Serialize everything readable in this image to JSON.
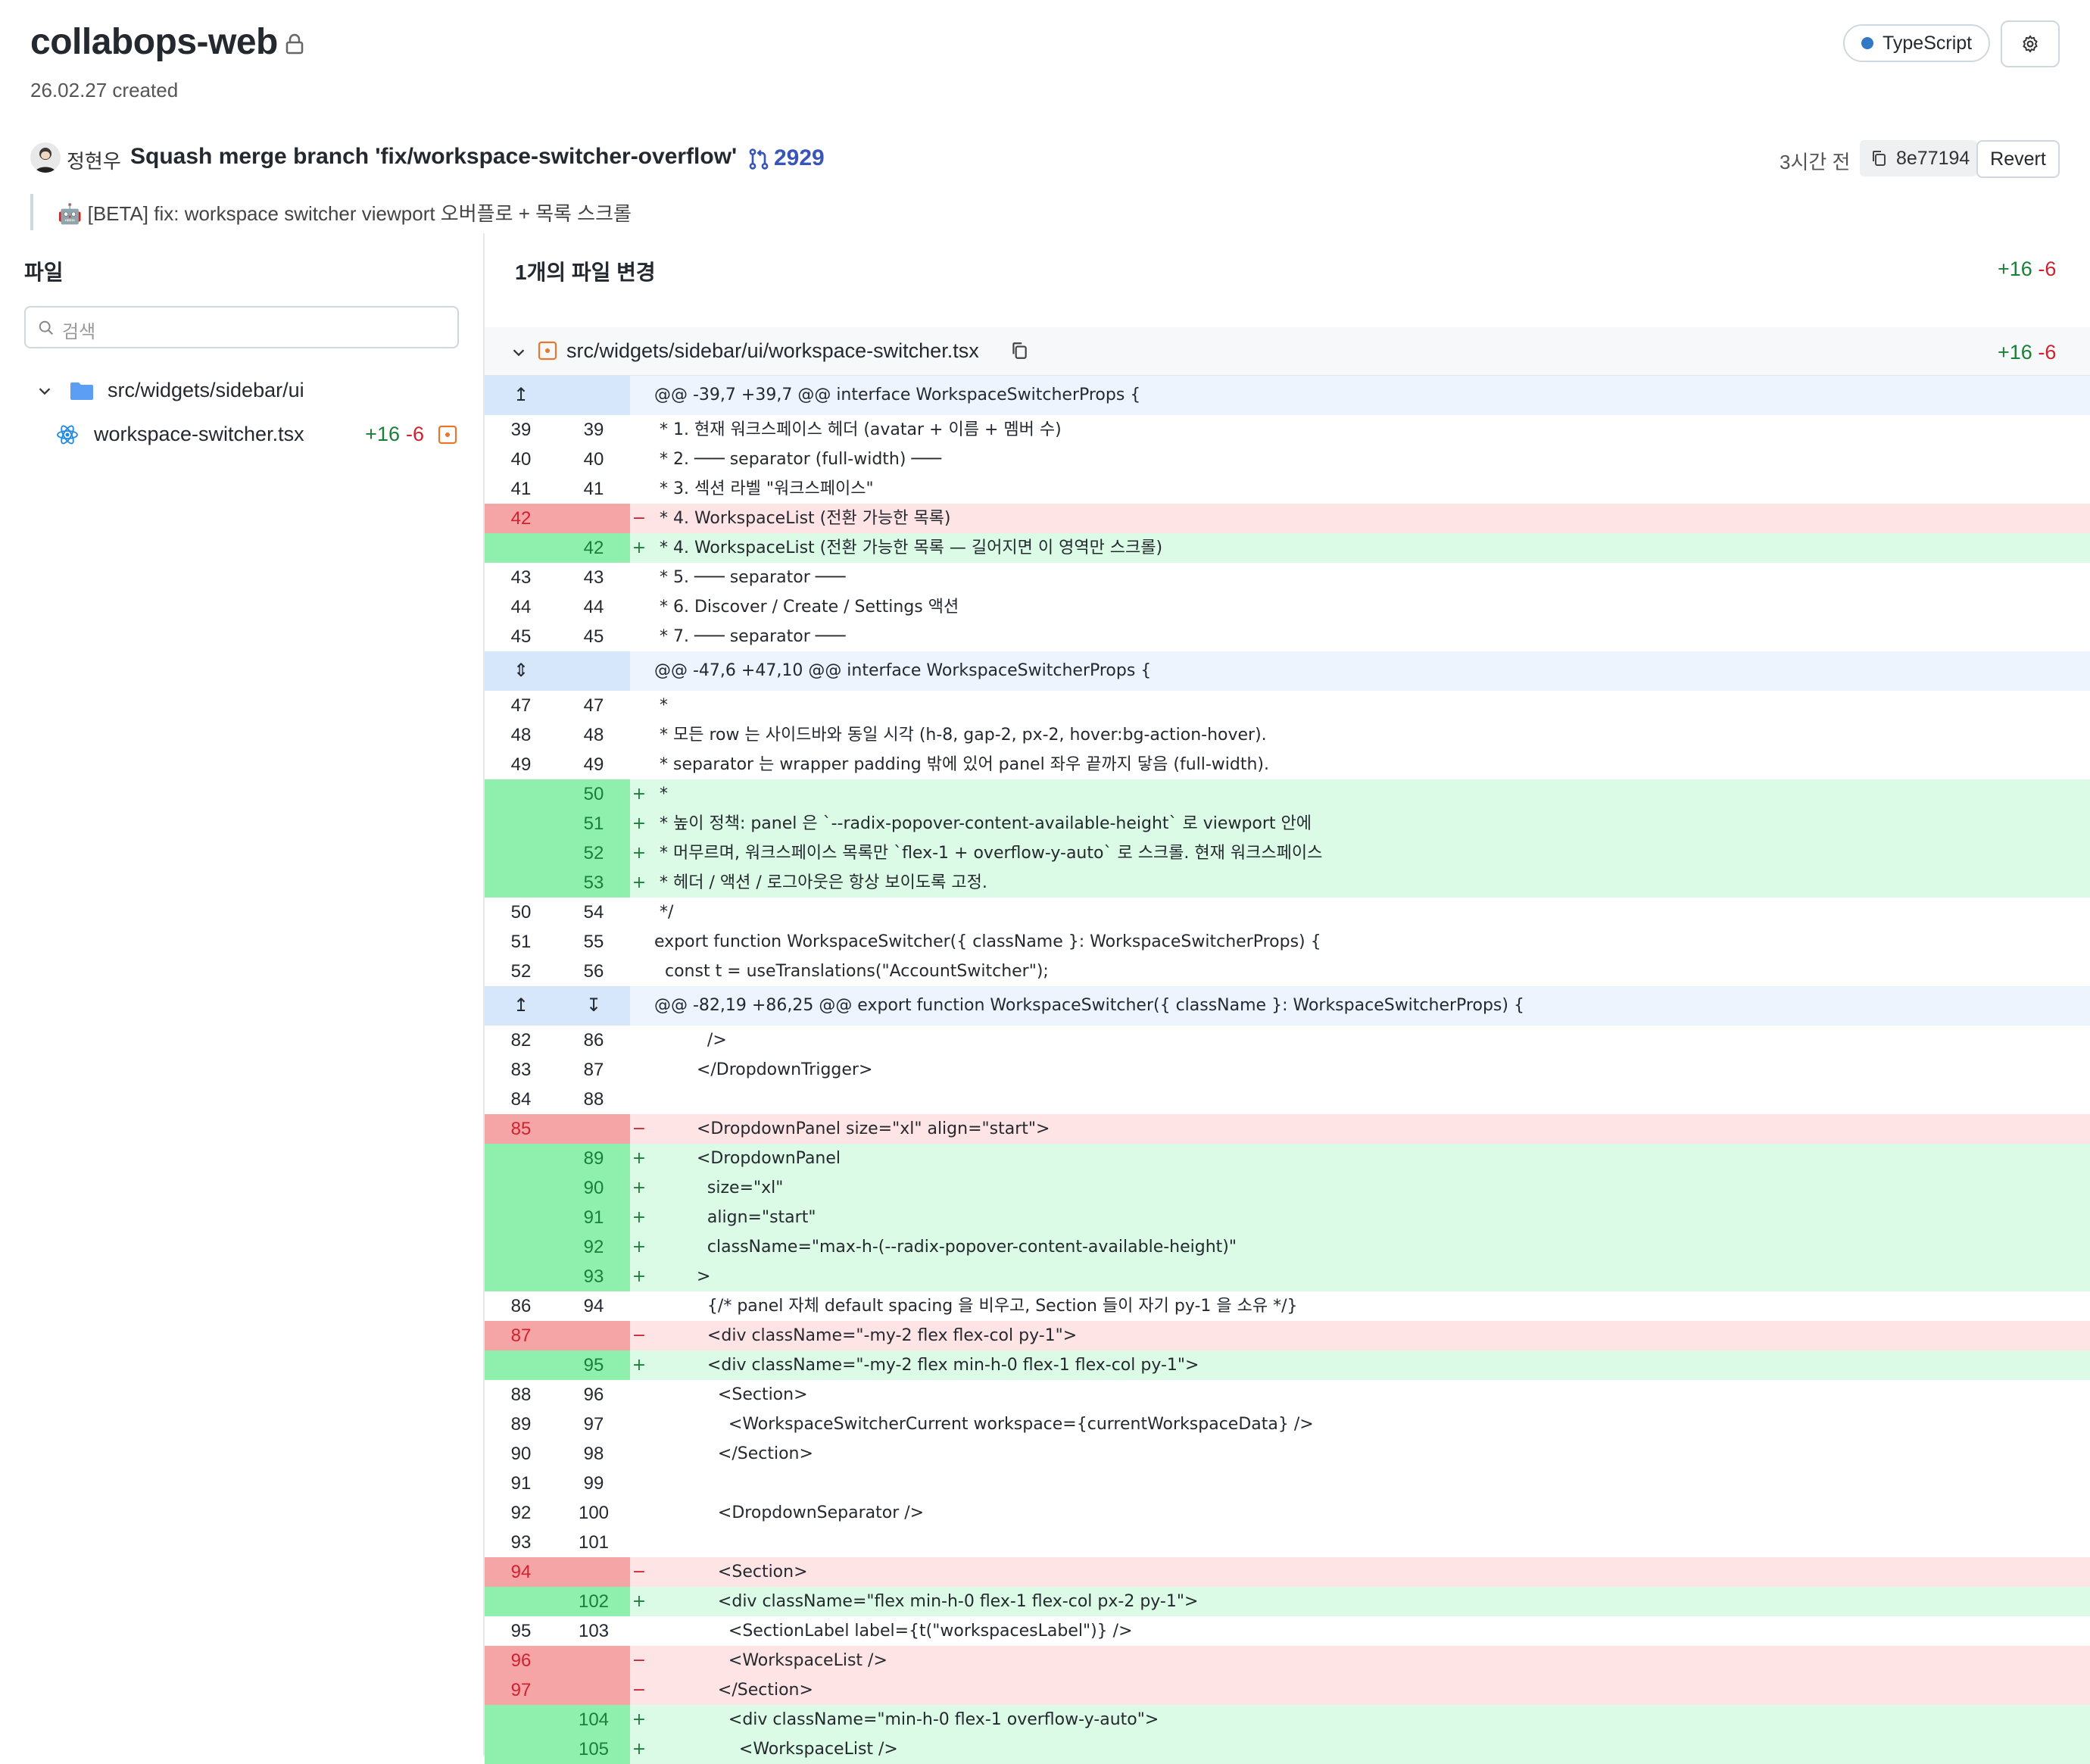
{
  "repo": {
    "name": "collabops-web",
    "created": "26.02.27 created",
    "language": "TypeScript",
    "language_color": "#3178c6"
  },
  "commit": {
    "author": "정현우",
    "message": "Squash merge branch 'fix/workspace-switcher-overflow'",
    "pr_number": "2929",
    "time": "3시간 전",
    "hash": "8e77194",
    "revert_label": "Revert",
    "body": "🤖 [BETA] fix: workspace switcher viewport 오버플로 + 목록 스크롤"
  },
  "sidebar": {
    "title": "파일",
    "search_placeholder": "검색",
    "folder": "src/widgets/sidebar/ui",
    "file": {
      "name": "workspace-switcher.tsx",
      "additions": "+16",
      "deletions": "-6"
    }
  },
  "changes": {
    "title": "1개의 파일 변경",
    "additions": "+16",
    "deletions": "-6"
  },
  "file_header": {
    "path": "src/widgets/sidebar/ui/workspace-switcher.tsx",
    "additions": "+16",
    "deletions": "-6"
  },
  "diff": [
    {
      "t": "hunk",
      "a": "↥",
      "b": "",
      "c": "@@ -39,7 +39,7 @@ interface WorkspaceSwitcherProps {"
    },
    {
      "t": "ctx",
      "a": "39",
      "b": "39",
      "c": " * 1. 현재 워크스페이스 헤더 (avatar + 이름 + 멤버 수)"
    },
    {
      "t": "ctx",
      "a": "40",
      "b": "40",
      "c": " * 2. ─── separator (full-width) ───"
    },
    {
      "t": "ctx",
      "a": "41",
      "b": "41",
      "c": " * 3. 섹션 라벨 \"워크스페이스\""
    },
    {
      "t": "del",
      "a": "42",
      "b": "",
      "c": " * 4. WorkspaceList (전환 가능한 목록)"
    },
    {
      "t": "add",
      "a": "",
      "b": "42",
      "c": " * 4. WorkspaceList (전환 가능한 목록 — 길어지면 이 영역만 스크롤)"
    },
    {
      "t": "ctx",
      "a": "43",
      "b": "43",
      "c": " * 5. ─── separator ───"
    },
    {
      "t": "ctx",
      "a": "44",
      "b": "44",
      "c": " * 6. Discover / Create / Settings 액션"
    },
    {
      "t": "ctx",
      "a": "45",
      "b": "45",
      "c": " * 7. ─── separator ───"
    },
    {
      "t": "hunk",
      "a": "⇕",
      "b": "",
      "c": "@@ -47,6 +47,10 @@ interface WorkspaceSwitcherProps {"
    },
    {
      "t": "ctx",
      "a": "47",
      "b": "47",
      "c": " *"
    },
    {
      "t": "ctx",
      "a": "48",
      "b": "48",
      "c": " * 모든 row 는 사이드바와 동일 시각 (h-8, gap-2, px-2, hover:bg-action-hover)."
    },
    {
      "t": "ctx",
      "a": "49",
      "b": "49",
      "c": " * separator 는 wrapper padding 밖에 있어 panel 좌우 끝까지 닿음 (full-width)."
    },
    {
      "t": "add",
      "a": "",
      "b": "50",
      "c": " *"
    },
    {
      "t": "add",
      "a": "",
      "b": "51",
      "c": " * 높이 정책: panel 은 `--radix-popover-content-available-height` 로 viewport 안에"
    },
    {
      "t": "add",
      "a": "",
      "b": "52",
      "c": " * 머무르며, 워크스페이스 목록만 `flex-1 + overflow-y-auto` 로 스크롤. 현재 워크스페이스"
    },
    {
      "t": "add",
      "a": "",
      "b": "53",
      "c": " * 헤더 / 액션 / 로그아웃은 항상 보이도록 고정."
    },
    {
      "t": "ctx",
      "a": "50",
      "b": "54",
      "c": " */"
    },
    {
      "t": "ctx",
      "a": "51",
      "b": "55",
      "c": "export function WorkspaceSwitcher({ className }: WorkspaceSwitcherProps) {"
    },
    {
      "t": "ctx",
      "a": "52",
      "b": "56",
      "c": "  const t = useTranslations(\"AccountSwitcher\");"
    },
    {
      "t": "hunk",
      "a": "↥",
      "b": "↧",
      "c": "@@ -82,19 +86,25 @@ export function WorkspaceSwitcher({ className }: WorkspaceSwitcherProps) {"
    },
    {
      "t": "ctx",
      "a": "82",
      "b": "86",
      "c": "          />"
    },
    {
      "t": "ctx",
      "a": "83",
      "b": "87",
      "c": "        </DropdownTrigger>"
    },
    {
      "t": "ctx",
      "a": "84",
      "b": "88",
      "c": ""
    },
    {
      "t": "del",
      "a": "85",
      "b": "",
      "c": "        <DropdownPanel size=\"xl\" align=\"start\">"
    },
    {
      "t": "add",
      "a": "",
      "b": "89",
      "c": "        <DropdownPanel"
    },
    {
      "t": "add",
      "a": "",
      "b": "90",
      "c": "          size=\"xl\""
    },
    {
      "t": "add",
      "a": "",
      "b": "91",
      "c": "          align=\"start\""
    },
    {
      "t": "add",
      "a": "",
      "b": "92",
      "c": "          className=\"max-h-(--radix-popover-content-available-height)\""
    },
    {
      "t": "add",
      "a": "",
      "b": "93",
      "c": "        >"
    },
    {
      "t": "ctx",
      "a": "86",
      "b": "94",
      "c": "          {/* panel 자체 default spacing 을 비우고, Section 들이 자기 py-1 을 소유 */}"
    },
    {
      "t": "del",
      "a": "87",
      "b": "",
      "c": "          <div className=\"-my-2 flex flex-col py-1\">"
    },
    {
      "t": "add",
      "a": "",
      "b": "95",
      "c": "          <div className=\"-my-2 flex min-h-0 flex-1 flex-col py-1\">"
    },
    {
      "t": "ctx",
      "a": "88",
      "b": "96",
      "c": "            <Section>"
    },
    {
      "t": "ctx",
      "a": "89",
      "b": "97",
      "c": "              <WorkspaceSwitcherCurrent workspace={currentWorkspaceData} />"
    },
    {
      "t": "ctx",
      "a": "90",
      "b": "98",
      "c": "            </Section>"
    },
    {
      "t": "ctx",
      "a": "91",
      "b": "99",
      "c": ""
    },
    {
      "t": "ctx",
      "a": "92",
      "b": "100",
      "c": "            <DropdownSeparator />"
    },
    {
      "t": "ctx",
      "a": "93",
      "b": "101",
      "c": ""
    },
    {
      "t": "del",
      "a": "94",
      "b": "",
      "c": "            <Section>"
    },
    {
      "t": "add",
      "a": "",
      "b": "102",
      "c": "            <div className=\"flex min-h-0 flex-1 flex-col px-2 py-1\">"
    },
    {
      "t": "ctx",
      "a": "95",
      "b": "103",
      "c": "              <SectionLabel label={t(\"workspacesLabel\")} />"
    },
    {
      "t": "del",
      "a": "96",
      "b": "",
      "c": "              <WorkspaceList />"
    },
    {
      "t": "del",
      "a": "97",
      "b": "",
      "c": "            </Section>"
    },
    {
      "t": "add",
      "a": "",
      "b": "104",
      "c": "              <div className=\"min-h-0 flex-1 overflow-y-auto\">"
    },
    {
      "t": "add",
      "a": "",
      "b": "105",
      "c": "                <WorkspaceList />"
    }
  ]
}
